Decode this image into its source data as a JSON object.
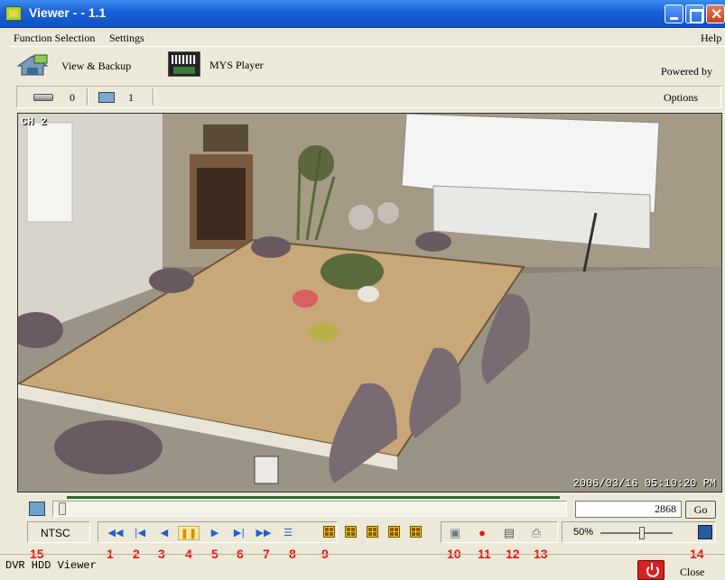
{
  "window": {
    "title": "Viewer -   - 1.1"
  },
  "menu": {
    "function_selection": "Function Selection",
    "settings": "Settings",
    "help": "Help"
  },
  "toolbar": {
    "view_backup": "View & Backup",
    "mys_player": "MYS Player",
    "powered_by": "Powered by"
  },
  "status_row": {
    "hdd_count": "0",
    "camera_count": "1",
    "options": "Options"
  },
  "video": {
    "channel": "CH 2",
    "timestamp": "2006/03/16 05:10:20 PM"
  },
  "seek": {
    "frame": "2868",
    "go": "Go",
    "progress": 0.0
  },
  "controls": {
    "video_standard": "NTSC",
    "playback_icons": [
      "fast-rewind-icon",
      "step-back-icon",
      "reverse-play-icon",
      "pause-icon",
      "play-icon",
      "step-forward-icon",
      "fast-forward-icon",
      "playlist-icon"
    ],
    "zoom": "50%"
  },
  "callouts": [
    "15",
    "1",
    "2",
    "3",
    "4",
    "5",
    "6",
    "7",
    "8",
    "9",
    "10",
    "11",
    "12",
    "13",
    "14"
  ],
  "statusbar": {
    "text": "DVR HDD Viewer",
    "close": "Close"
  },
  "colors": {
    "title_bar": "#1a5fd6",
    "callout_red": "#e8140c",
    "power_red": "#d82020"
  }
}
